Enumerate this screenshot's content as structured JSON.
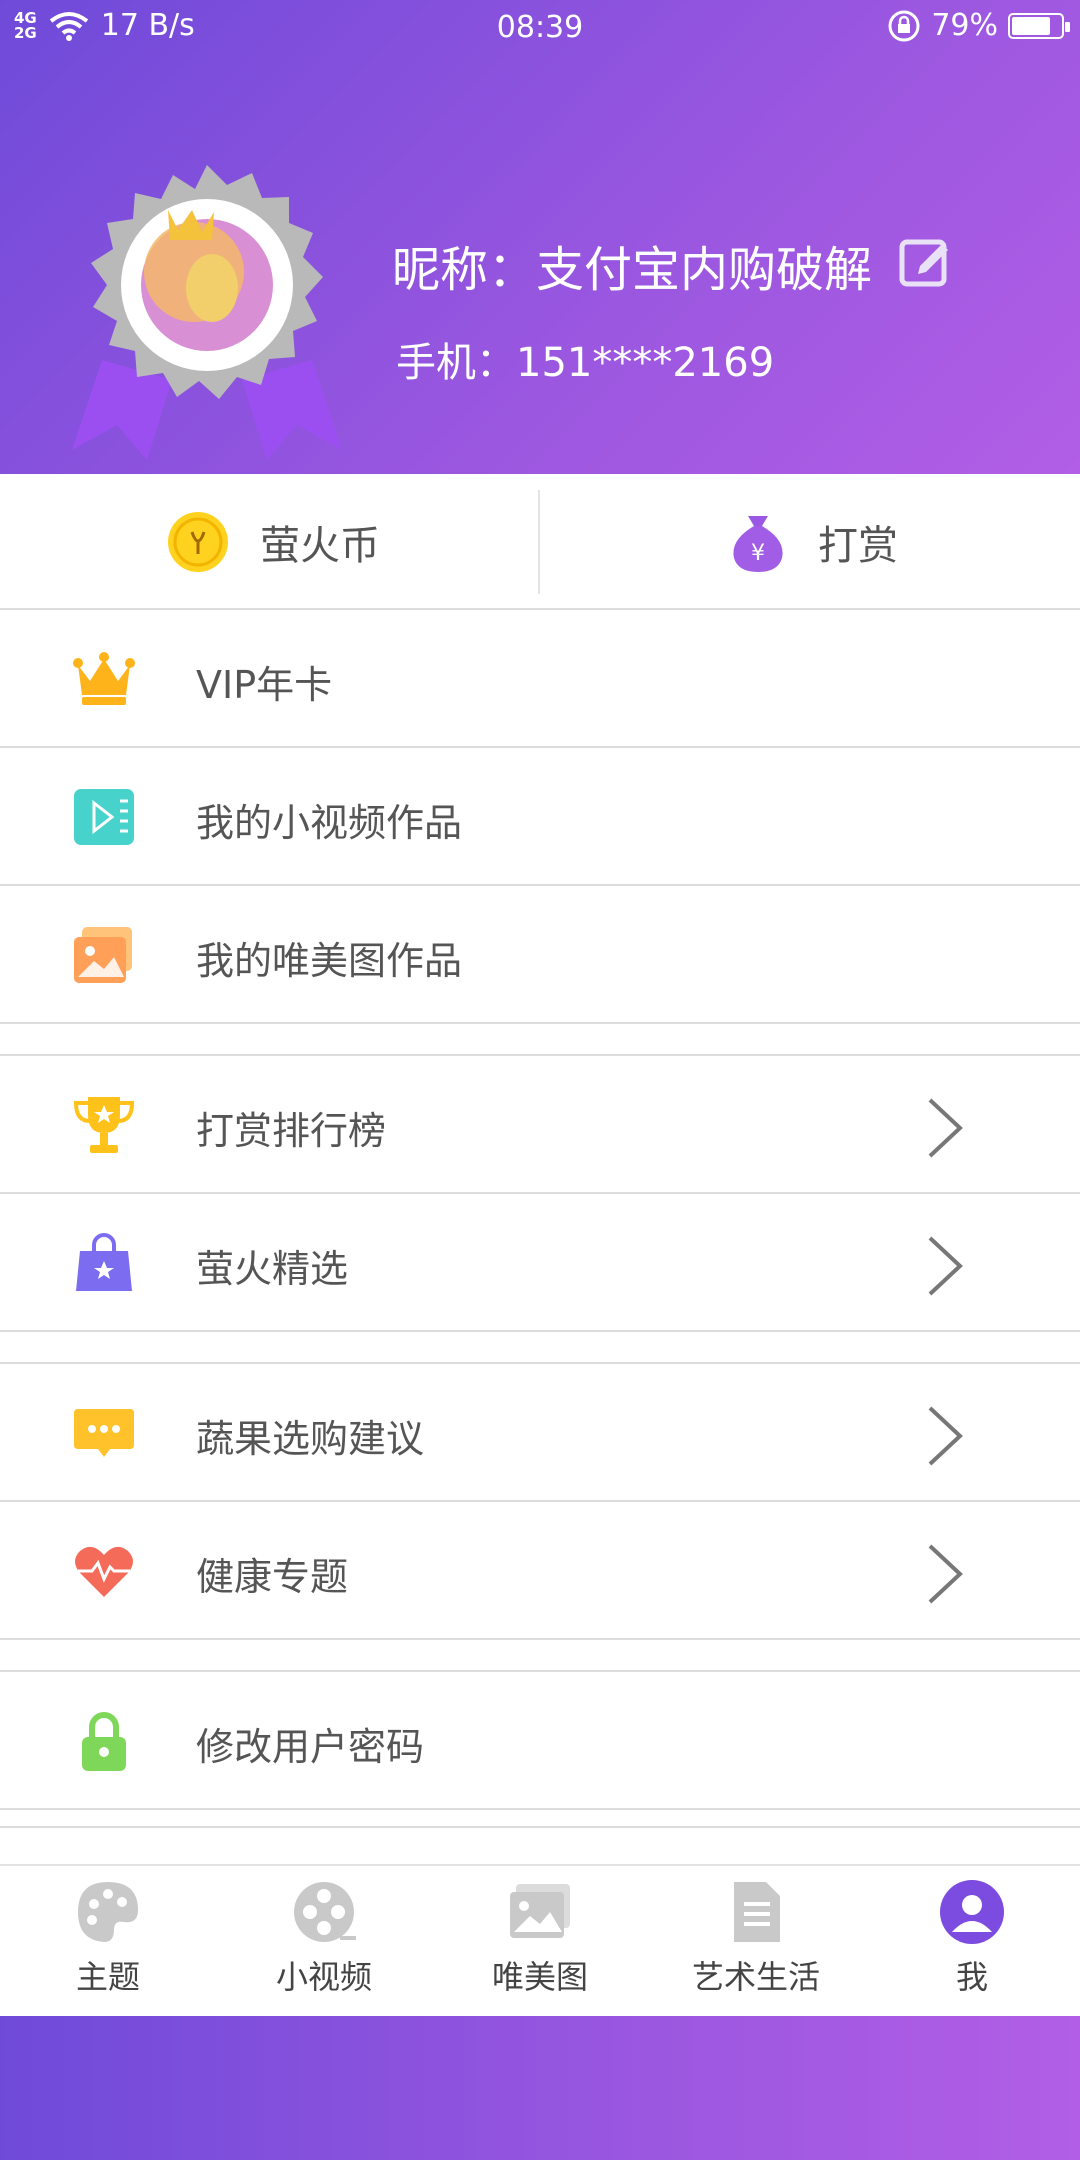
{
  "status_bar": {
    "network": "4G\n2G",
    "speed": "17 B/s",
    "time": "08:39",
    "battery": "79%",
    "battery_level": 0.79
  },
  "profile": {
    "nickname_label": "昵称：支付宝内购破解",
    "phone_label": "手机：151****2169"
  },
  "quick_actions": [
    {
      "label": "萤火币",
      "icon": "coin-icon"
    },
    {
      "label": "打赏",
      "icon": "money-bag-icon"
    }
  ],
  "menu": {
    "group1": [
      {
        "label": "VIP年卡",
        "icon": "crown-icon"
      },
      {
        "label": "我的小视频作品",
        "icon": "video-icon"
      },
      {
        "label": "我的唯美图作品",
        "icon": "image-icon"
      }
    ],
    "group2": [
      {
        "label": "打赏排行榜",
        "icon": "trophy-icon"
      },
      {
        "label": "萤火精选",
        "icon": "shopping-bag-icon"
      }
    ],
    "group3": [
      {
        "label": "蔬果选购建议",
        "icon": "chat-icon"
      },
      {
        "label": "健康专题",
        "icon": "heart-icon"
      }
    ],
    "group4": [
      {
        "label": "修改用户密码",
        "icon": "lock-icon"
      }
    ]
  },
  "tabs": [
    {
      "label": "主题",
      "icon": "palette-icon",
      "active": false
    },
    {
      "label": "小视频",
      "icon": "film-reel-icon",
      "active": false
    },
    {
      "label": "唯美图",
      "icon": "picture-icon",
      "active": false
    },
    {
      "label": "艺术生活",
      "icon": "document-icon",
      "active": false
    },
    {
      "label": "我",
      "icon": "user-icon",
      "active": true
    }
  ],
  "colors": {
    "header_start": "#6f4ad9",
    "header_end": "#b25ee6",
    "divider": "#dcdcdc",
    "active_tab": "#7c4be0"
  }
}
